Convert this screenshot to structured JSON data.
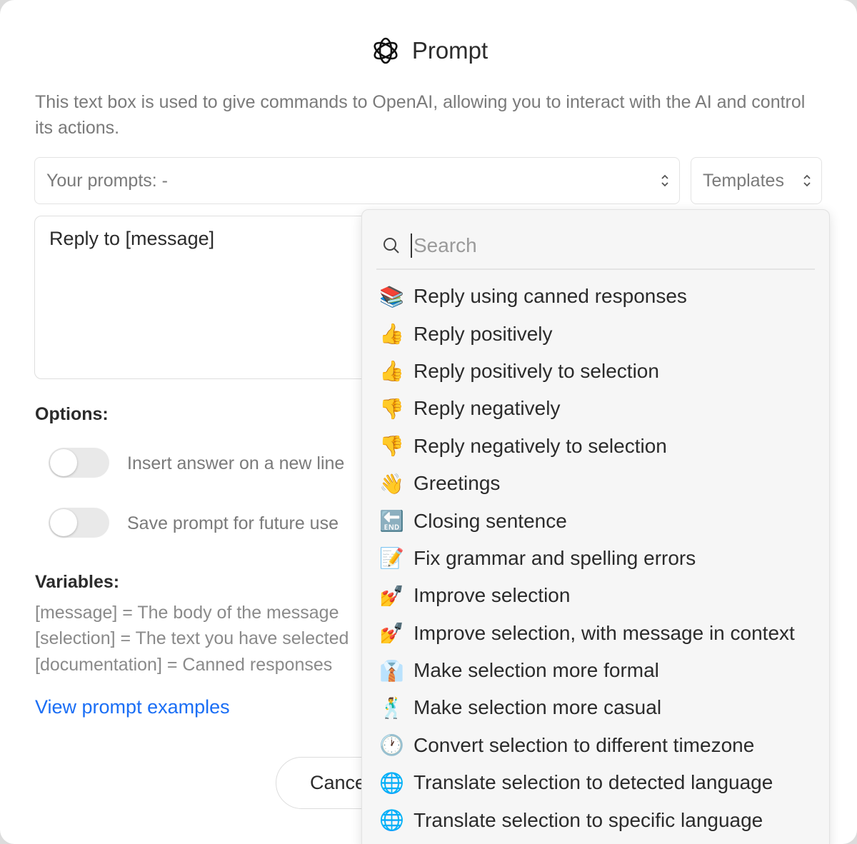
{
  "dialog": {
    "title": "Prompt",
    "description": "This text box is used to give commands to OpenAI, allowing you to interact with the AI and control its actions.",
    "prompts_select": "Your prompts: -",
    "templates_select": "Templates",
    "prompt_text": "Reply to [message]",
    "options_heading": "Options:",
    "options": [
      {
        "label": "Insert answer on a new line",
        "enabled": false
      },
      {
        "label": "Save prompt for future use",
        "enabled": false
      }
    ],
    "variables_heading": "Variables:",
    "variables": [
      "[message] = The body of the message",
      "[selection] = The text you have selected",
      "[documentation] = Canned responses"
    ],
    "examples_link": "View prompt examples",
    "cancel_label": "Cancel",
    "link_color": "#1a6ef5"
  },
  "templates_dropdown": {
    "search_placeholder": "Search",
    "items": [
      {
        "emoji": "📚",
        "label": "Reply using canned responses"
      },
      {
        "emoji": "👍",
        "label": "Reply positively"
      },
      {
        "emoji": "👍",
        "label": "Reply positively to selection"
      },
      {
        "emoji": "👎",
        "label": "Reply negatively"
      },
      {
        "emoji": "👎",
        "label": "Reply negatively to selection"
      },
      {
        "emoji": "👋",
        "label": "Greetings"
      },
      {
        "emoji": "🔚",
        "label": "Closing sentence"
      },
      {
        "emoji": "📝",
        "label": "Fix grammar and spelling errors"
      },
      {
        "emoji": "💅",
        "label": "Improve selection"
      },
      {
        "emoji": "💅",
        "label": "Improve selection, with message in context"
      },
      {
        "emoji": "👔",
        "label": "Make selection more formal"
      },
      {
        "emoji": "🕺",
        "label": "Make selection more casual"
      },
      {
        "emoji": "🕐",
        "label": "Convert selection to different timezone"
      },
      {
        "emoji": "🌐",
        "label": "Translate selection to detected language"
      },
      {
        "emoji": "🌐",
        "label": "Translate selection to specific language"
      }
    ]
  }
}
